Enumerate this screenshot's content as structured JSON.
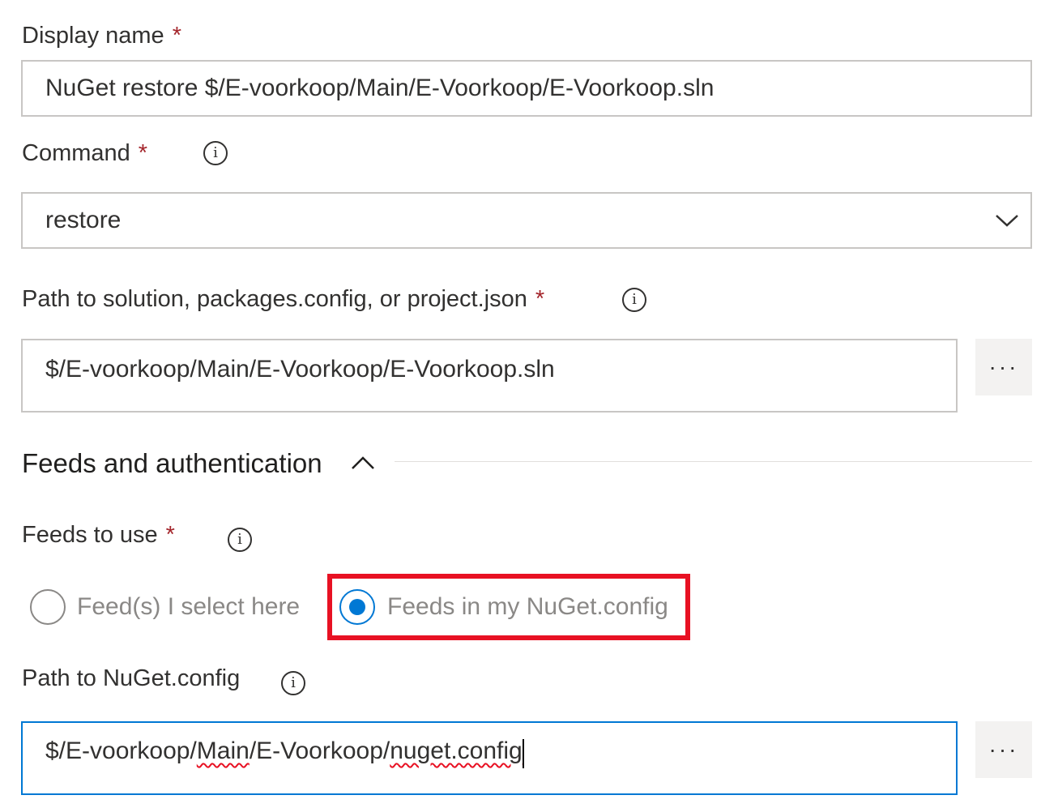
{
  "display_name": {
    "label": "Display name",
    "required_marker": "*",
    "value": "NuGet restore $/E-voorkoop/Main/E-Voorkoop/E-Voorkoop.sln"
  },
  "command": {
    "label": "Command",
    "required_marker": "*",
    "info_glyph": "i",
    "selected": "restore",
    "icon": "chevron-down-icon"
  },
  "solution_path": {
    "label": "Path to solution, packages.config, or project.json",
    "required_marker": "*",
    "info_glyph": "i",
    "value": "$/E-voorkoop/Main/E-Voorkoop/E-Voorkoop.sln",
    "browse_label": "···"
  },
  "feeds_section": {
    "title": "Feeds and authentication",
    "icon": "chevron-up-icon"
  },
  "feeds_to_use": {
    "label": "Feeds to use",
    "required_marker": "*",
    "info_glyph": "i",
    "options": [
      {
        "label": "Feed(s) I select here",
        "checked": false
      },
      {
        "label": "Feeds in my NuGet.config",
        "checked": true
      }
    ],
    "highlight_color": "#e81123"
  },
  "nuget_config_path": {
    "label": "Path to NuGet.config",
    "info_glyph": "i",
    "value_parts": [
      "$/E-voorkoop/",
      "Main",
      "/E-Voorkoop/",
      "nuget.config"
    ],
    "browse_label": "···"
  },
  "colors": {
    "accent": "#0078d4",
    "required": "#a4262c",
    "border": "#c8c6c4"
  }
}
